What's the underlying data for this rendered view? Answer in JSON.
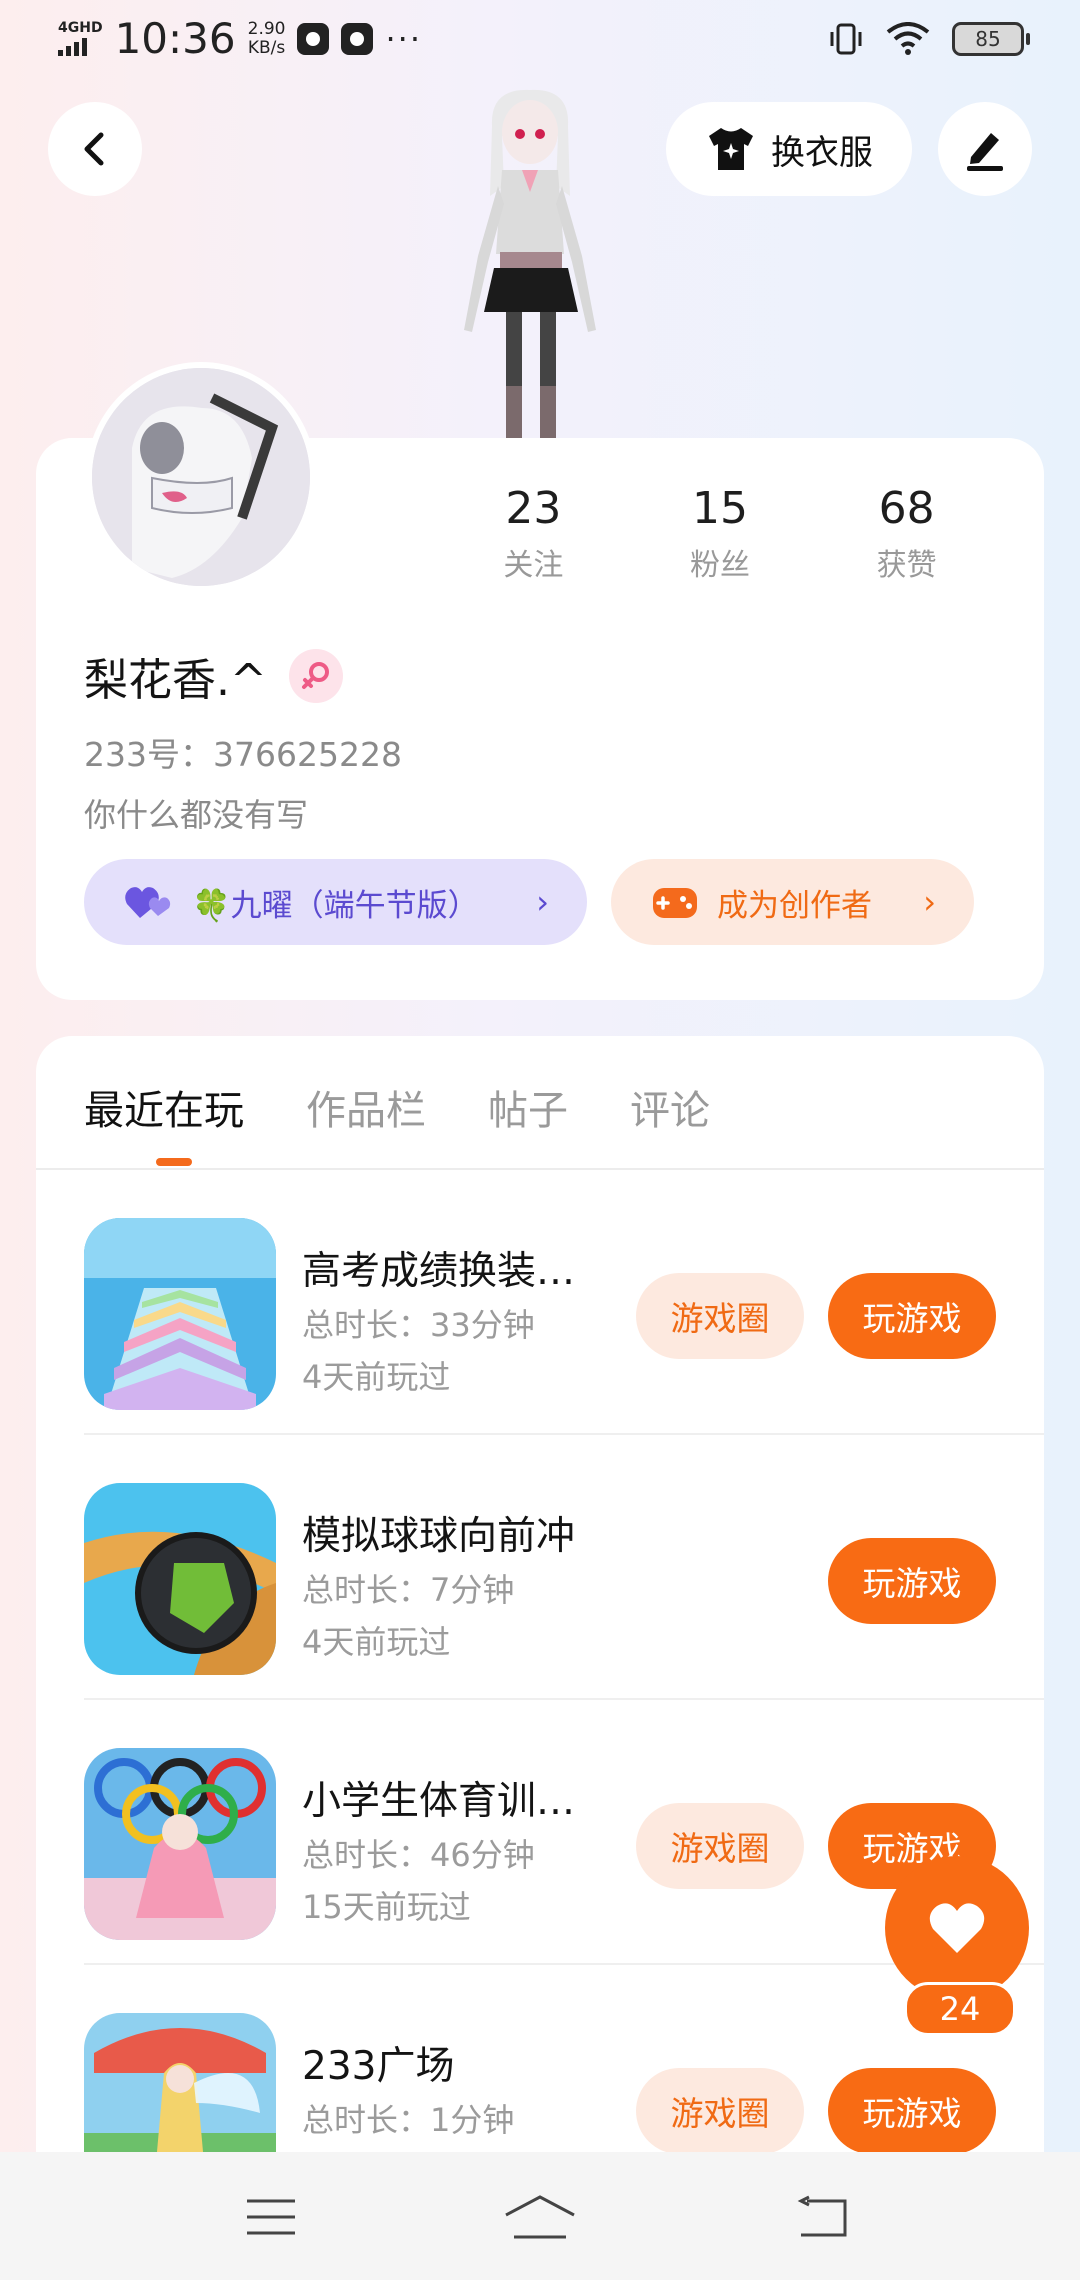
{
  "status_bar": {
    "network": "4GHD",
    "time": "10:36",
    "speed_value": "2.90",
    "speed_unit": "KB/s",
    "more": "···",
    "battery": "85"
  },
  "header": {
    "back_icon": "chevron-left-icon",
    "dress_label": "换衣服",
    "dress_icon": "tshirt-sparkle-icon",
    "edit_icon": "pen-icon"
  },
  "profile": {
    "stats": [
      {
        "num": "23",
        "label": "关注"
      },
      {
        "num": "15",
        "label": "粉丝"
      },
      {
        "num": "68",
        "label": "获赞"
      }
    ],
    "name": "梨花香.^",
    "gender_icon": "female-icon",
    "uid": "233号：376625228",
    "bio": "你什么都没有写",
    "badge_label": "🍀九曜（端午节版）",
    "badge_icon": "hearts-icon",
    "creator_label": "成为创作者",
    "creator_icon": "gamepad-icon",
    "chev": "›"
  },
  "tabs": [
    "最近在玩",
    "作品栏",
    "帖子",
    "评论"
  ],
  "games": [
    {
      "title": "高考成绩换装…",
      "duration": "总时长：33分钟",
      "last": "4天前玩过",
      "circle": "游戏圈",
      "play": "玩游戏"
    },
    {
      "title": "模拟球球向前冲",
      "duration": "总时长：7分钟",
      "last": "4天前玩过",
      "circle": "",
      "play": "玩游戏"
    },
    {
      "title": "小学生体育训…",
      "duration": "总时长：46分钟",
      "last": "15天前玩过",
      "circle": "游戏圈",
      "play": "玩游戏"
    },
    {
      "title": "233广场",
      "duration": "总时长：1分钟",
      "last": "",
      "circle": "游戏圈",
      "play": "玩游戏"
    }
  ],
  "like_fab": {
    "icon": "heart-icon",
    "count": "24"
  },
  "nav": {
    "menu_icon": "menu-icon",
    "home_icon": "home-icon",
    "back_icon": "back-icon"
  },
  "colors": {
    "accent": "#f86b14",
    "accent_light": "#fde9df",
    "purple_light": "#e4e0fb",
    "purple": "#5b4ad0"
  }
}
